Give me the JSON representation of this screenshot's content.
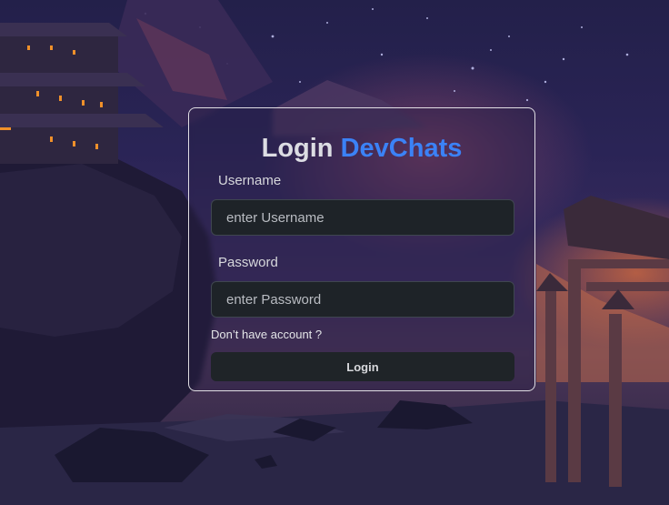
{
  "login": {
    "title": "Login",
    "brand": "DevChats",
    "username_label": "Username",
    "username_placeholder": "enter Username",
    "password_label": "Password",
    "password_placeholder": "enter Password",
    "signup_link": "Don’t have account ?",
    "submit_label": "Login"
  },
  "colors": {
    "brand": "#3b82f6",
    "input_bg": "#1e2328",
    "button_bg": "#1f2428",
    "card_border": "#ffffff"
  }
}
